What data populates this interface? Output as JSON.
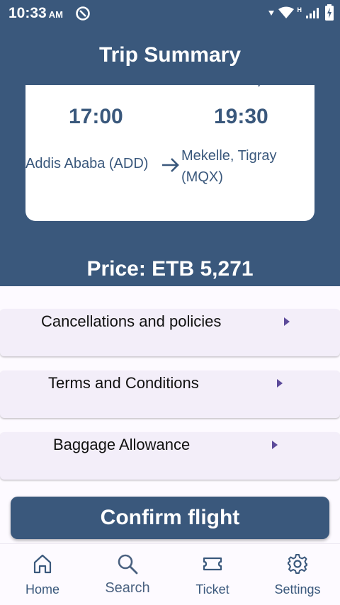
{
  "status_bar": {
    "time": "10:33",
    "ampm": "AM",
    "network_label": "H",
    "icons": [
      "app-notification-icon",
      "wifi-icon",
      "signal-icon",
      "battery-charging-icon"
    ]
  },
  "app_bar": {
    "title": "Trip Summary"
  },
  "trip": {
    "departure_time": "17:00",
    "arrival_time": "19:30",
    "origin": "Addis Ababa (ADD)",
    "destination": "Mekelle, Tigray (MQX)",
    "route_icon": "arrow-right-icon"
  },
  "price": "Price: ETB 5,271",
  "sections": [
    {
      "label": "Cancellations and policies",
      "icon": "caret-right-icon"
    },
    {
      "label": "Terms and Conditions",
      "icon": "caret-right-icon"
    },
    {
      "label": "Baggage Allowance",
      "icon": "caret-right-icon"
    }
  ],
  "confirm_button": "Confirm flight",
  "bottom_nav": [
    {
      "label": "Home",
      "icon": "home-icon"
    },
    {
      "label": "Search",
      "icon": "search-icon"
    },
    {
      "label": "Ticket",
      "icon": "ticket-icon"
    },
    {
      "label": "Settings",
      "icon": "gear-icon"
    }
  ],
  "colors": {
    "primary": "#3a587c",
    "background": "#fdfaff",
    "accordion": "#f3eef9",
    "accent": "#5c4a9a"
  }
}
